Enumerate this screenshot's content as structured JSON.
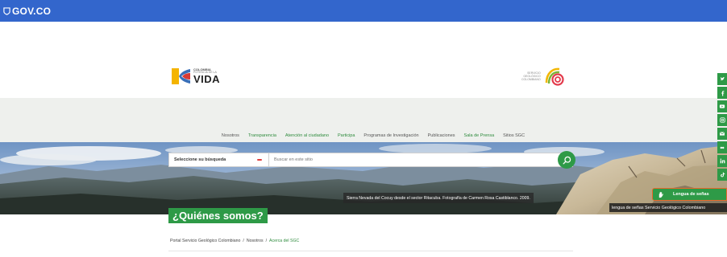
{
  "govbar": {
    "label": "GOV.CO",
    "color": "#3366cc"
  },
  "header": {
    "left_logo": {
      "line1": "COLOMBIA",
      "line2": "POTENCIA DE LA",
      "word": "VIDA"
    },
    "right_logo": {
      "line1": "SERVICIO",
      "line2": "GEOLÓGICO",
      "line3": "COLOMBIANO"
    }
  },
  "nav": {
    "items": [
      {
        "label": "Nosotros",
        "accent": false
      },
      {
        "label": "Transparencia",
        "accent": true
      },
      {
        "label": "Atención al ciudadano",
        "accent": true
      },
      {
        "label": "Participa",
        "accent": true
      },
      {
        "label": "Programas de Investigación",
        "accent": false
      },
      {
        "label": "Publicaciones",
        "accent": false
      },
      {
        "label": "Sala de Prensa",
        "accent": true
      },
      {
        "label": "Sitios SGC",
        "accent": false
      }
    ]
  },
  "search": {
    "select_label": "Seleccione su búsqueda",
    "placeholder": "Buscar en este sitio",
    "button_icon": "search-icon"
  },
  "hero": {
    "caption": "Sierra Nevada del Cocuy desde el sector Ritacuba. Fotografía de Carmen Rosa Castiblanco. 2009."
  },
  "page_title": "¿Quiénes somos?",
  "breadcrumb": {
    "items": [
      "Portal Servicio Geológico Colombiano",
      "Nosotros",
      "Acerca del SGC"
    ],
    "separator": "/"
  },
  "social": {
    "icons": [
      "twitter-icon",
      "facebook-icon",
      "youtube-icon",
      "instagram-icon",
      "email-icon",
      "flickr-icon",
      "linkedin-icon",
      "tiktok-icon"
    ]
  },
  "sign_language": {
    "button_label": "Lengua de señas",
    "tooltip": "lengua de señas Servicio Geológico Colombiano"
  },
  "colors": {
    "green": "#2e9a47",
    "orange": "#e8692b",
    "band": "#eef0ed"
  }
}
